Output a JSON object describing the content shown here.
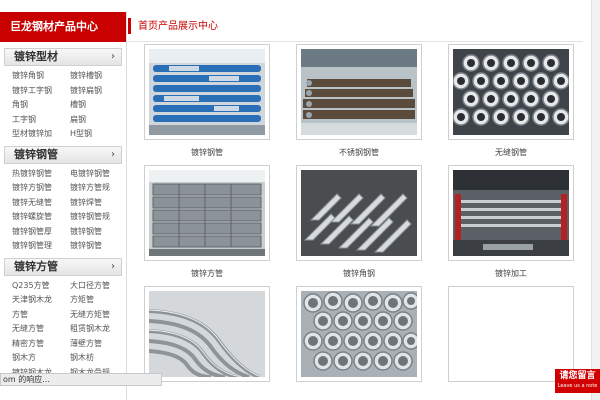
{
  "sidebar": {
    "title": "巨龙钢材产品中心",
    "categories": [
      {
        "title": "镀锌型材",
        "links": [
          "镀锌角钢",
          "镀锌槽钢",
          "镀锌工字钢",
          "镀锌扁钢",
          "角钢",
          "槽钢",
          "工字钢",
          "扁钢",
          "型材镀锌加",
          "H型钢"
        ]
      },
      {
        "title": "镀锌钢管",
        "links": [
          "热镀锌钢管",
          "电镀锌钢管",
          "镀锌方钢管",
          "镀锌方管规",
          "镀锌无缝管",
          "镀锌焊管",
          "镀锌螺旋管",
          "镀锌钢管规",
          "镀锌钢管厚",
          "镀锌钢管",
          "镀锌钢管理",
          "镀锌钢管"
        ]
      },
      {
        "title": "镀锌方管",
        "links": [
          "Q235方管",
          "大口径方管",
          "天津钢木龙",
          "方矩管",
          "方管",
          "无缝方矩管",
          "无缝方管",
          "租赁钢木龙",
          "精密方管",
          "薄壁方管",
          "钢木方",
          "钢木枋",
          "镀锌钢木龙",
          "钢木龙骨规"
        ]
      }
    ]
  },
  "main": {
    "title": "首页产品展示中心",
    "products": [
      {
        "caption": "镀锌钢管"
      },
      {
        "caption": "不锈钢钢管"
      },
      {
        "caption": "无缝钢管"
      },
      {
        "caption": "镀锌方管"
      },
      {
        "caption": "镀锌角钢"
      },
      {
        "caption": "镀锌加工"
      },
      {
        "caption": ""
      },
      {
        "caption": ""
      },
      {
        "caption": ""
      }
    ]
  },
  "statusbar": {
    "text": "om 的响应..."
  },
  "badge": {
    "line1": "请您留言",
    "line2": "Leave us a note"
  },
  "colors": {
    "brand_red": "#c80000",
    "border": "#cfcfcf",
    "text": "#444444"
  }
}
